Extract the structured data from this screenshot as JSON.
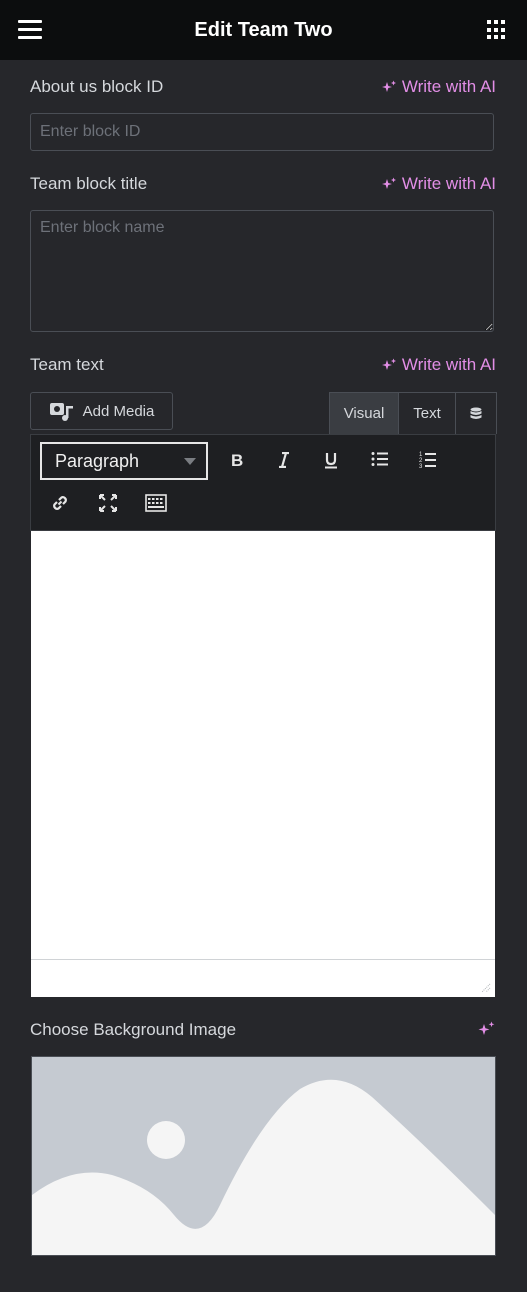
{
  "header": {
    "title": "Edit Team Two",
    "menu_icon": "hamburger-menu-icon",
    "apps_icon": "apps-grid-icon"
  },
  "fields": {
    "block_id": {
      "label": "About us block ID",
      "ai_label": "Write with AI",
      "placeholder": "Enter block ID",
      "value": ""
    },
    "block_title": {
      "label": "Team block title",
      "ai_label": "Write with AI",
      "placeholder": "Enter block name",
      "value": ""
    },
    "team_text": {
      "label": "Team text",
      "ai_label": "Write with AI"
    }
  },
  "editor": {
    "add_media_label": "Add Media",
    "tabs": [
      {
        "label": "Visual",
        "active": true
      },
      {
        "label": "Text",
        "active": false
      }
    ],
    "format_select": "Paragraph",
    "toolbar_icons": [
      "bold-icon",
      "italic-icon",
      "underline-icon",
      "bullet-list-icon",
      "numbered-list-icon",
      "link-icon",
      "fullscreen-icon",
      "keyboard-toolbar-icon"
    ],
    "content": ""
  },
  "background": {
    "label": "Choose Background Image",
    "placeholder_icon": "image-placeholder-icon"
  },
  "colors": {
    "panel_bg": "#26272b",
    "header_bg": "#0c0d0e",
    "ai_accent": "#e28ee6",
    "border": "#4a4e55",
    "image_placeholder": "#c5cad1"
  }
}
